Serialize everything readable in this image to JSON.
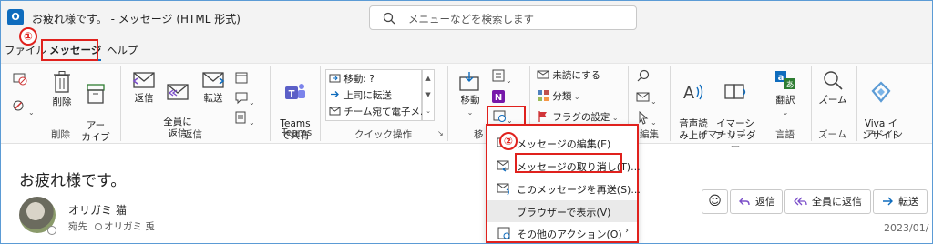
{
  "window": {
    "title": "お疲れ様です。 - メッセージ (HTML 形式)",
    "app_icon": "O"
  },
  "search": {
    "placeholder": "メニューなどを検索します"
  },
  "menu": {
    "tabs": [
      "ファイル",
      "メッセージ",
      "ヘルプ"
    ],
    "active": "メッセージ"
  },
  "markers": {
    "m1": "①",
    "m2": "②"
  },
  "ribbon": {
    "delete": {
      "delete_label": "削除",
      "archive_label": "アー\nカイブ",
      "group": "削除"
    },
    "respond": {
      "reply": "返信",
      "reply_all": "全員に\n返信",
      "forward": "転送",
      "group": "返信"
    },
    "teams": {
      "share": "Teams\nで共有",
      "group": "Teams"
    },
    "quick_steps": {
      "items": [
        "移動: ?",
        "上司に転送",
        "チーム宛て電子メ..."
      ],
      "group": "クイック操作"
    },
    "move": {
      "move_label": "移動",
      "group_partial": "移"
    },
    "tags": {
      "unread": "未読にする",
      "categorize": "分類",
      "flag": "フラグの設定"
    },
    "editing": {
      "group_partial": "編集"
    },
    "immersive": {
      "read_aloud": "音声読\nみ上げ",
      "immersive_reader": "イマーシ\nブ リーダー",
      "group": "イマーシブ"
    },
    "language": {
      "translate": "翻訳",
      "group": "言語"
    },
    "zoom": {
      "zoom": "ズーム",
      "group": "ズーム"
    },
    "addin": {
      "viva": "Viva イ\nンサイト",
      "group": "アドイン"
    }
  },
  "dropdown": {
    "items": [
      {
        "label": "メッセージの編集(E)",
        "icon": "edit-message-icon"
      },
      {
        "label": "メッセージの取り消し(T)...",
        "icon": "recall-message-icon"
      },
      {
        "label": "このメッセージを再送(S)...",
        "icon": "resend-icon"
      },
      {
        "label": "ブラウザーで表示(V)",
        "icon": ""
      },
      {
        "label": "その他のアクション(O)",
        "icon": "more-actions-icon"
      }
    ]
  },
  "message": {
    "subject": "お疲れ様です。",
    "sender": "オリガミ 猫",
    "to_label": "宛先",
    "to_name": "オリガミ 兎",
    "date": "2023/01/"
  },
  "actions": {
    "emoji": "☺",
    "reply": "返信",
    "reply_all": "全員に返信",
    "forward": "転送"
  },
  "colors": {
    "accent": "#0f6cbd",
    "highlight": "#e0211d"
  }
}
